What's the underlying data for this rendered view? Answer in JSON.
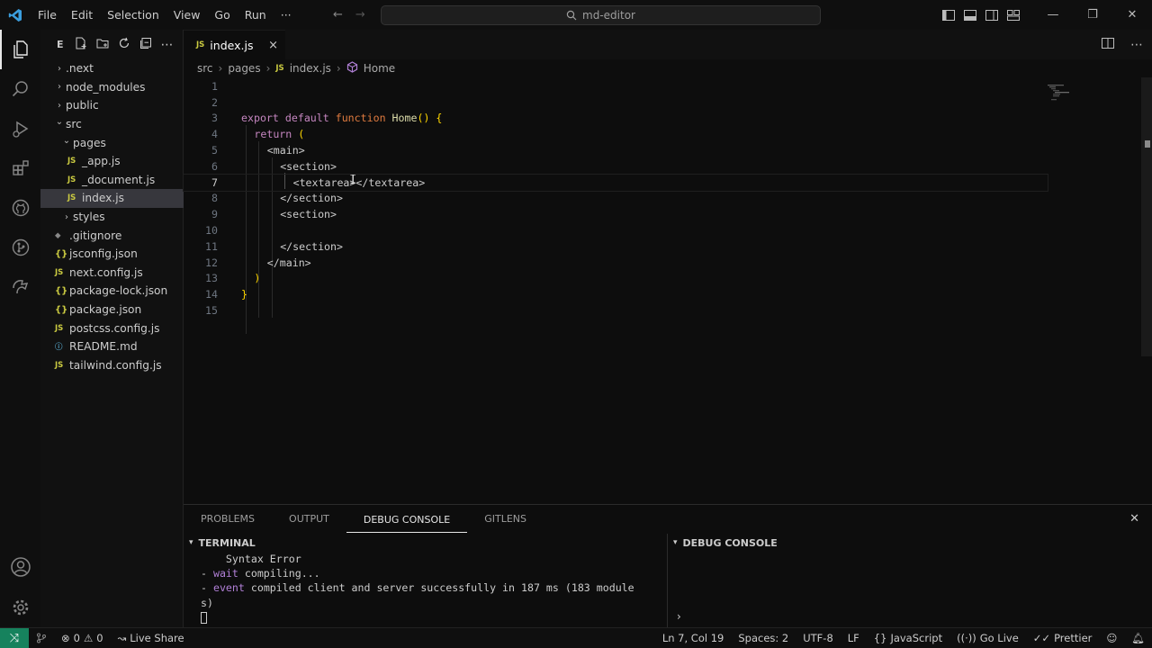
{
  "menu": [
    "File",
    "Edit",
    "Selection",
    "View",
    "Go",
    "Run",
    "···"
  ],
  "command_center": {
    "text": "md-editor"
  },
  "sidebar": {
    "header_letter": "E",
    "tree": [
      {
        "label": ".next",
        "type": "folder",
        "depth": 1,
        "open": false
      },
      {
        "label": "node_modules",
        "type": "folder",
        "depth": 1,
        "open": false
      },
      {
        "label": "public",
        "type": "folder",
        "depth": 1,
        "open": false
      },
      {
        "label": "src",
        "type": "folder",
        "depth": 1,
        "open": true
      },
      {
        "label": "pages",
        "type": "folder",
        "depth": 2,
        "open": true
      },
      {
        "label": "_app.js",
        "type": "js",
        "depth": 3
      },
      {
        "label": "_document.js",
        "type": "js",
        "depth": 3
      },
      {
        "label": "index.js",
        "type": "js",
        "depth": 3,
        "selected": true
      },
      {
        "label": "styles",
        "type": "folder",
        "depth": 2,
        "open": false
      },
      {
        "label": ".gitignore",
        "type": "git",
        "depth": 1
      },
      {
        "label": "jsconfig.json",
        "type": "json",
        "depth": 1
      },
      {
        "label": "next.config.js",
        "type": "js",
        "depth": 1
      },
      {
        "label": "package-lock.json",
        "type": "json",
        "depth": 1
      },
      {
        "label": "package.json",
        "type": "json",
        "depth": 1
      },
      {
        "label": "postcss.config.js",
        "type": "js",
        "depth": 1
      },
      {
        "label": "README.md",
        "type": "md",
        "depth": 1
      },
      {
        "label": "tailwind.config.js",
        "type": "js",
        "depth": 1
      }
    ]
  },
  "tab": {
    "label": "index.js",
    "icon_text": "JS",
    "close": "×"
  },
  "breadcrumb": {
    "parts": [
      "src",
      "pages",
      "index.js",
      "Home"
    ],
    "icon_text": "JS"
  },
  "editor": {
    "current_line": 7,
    "lines": [
      {
        "n": "1",
        "tokens": []
      },
      {
        "n": "2",
        "tokens": []
      },
      {
        "n": "3",
        "tokens": [
          {
            "t": "export ",
            "c": "k"
          },
          {
            "t": "default ",
            "c": "k"
          },
          {
            "t": "function ",
            "c": "kb"
          },
          {
            "t": "Home",
            "c": "fn"
          },
          {
            "t": "() {",
            "c": "pn"
          }
        ]
      },
      {
        "n": "4",
        "indent": 1,
        "tokens": [
          {
            "t": "return ",
            "c": "k"
          },
          {
            "t": "(",
            "c": "pn"
          }
        ]
      },
      {
        "n": "5",
        "indent": 2,
        "tokens": [
          {
            "t": "<main>",
            "c": "tg"
          }
        ]
      },
      {
        "n": "6",
        "indent": 3,
        "tokens": [
          {
            "t": "<section>",
            "c": "tg"
          }
        ]
      },
      {
        "n": "7",
        "indent": 4,
        "tokens": [
          {
            "t": "<textarea></textarea>",
            "c": "tg"
          }
        ]
      },
      {
        "n": "8",
        "indent": 3,
        "tokens": [
          {
            "t": "</section>",
            "c": "tg"
          }
        ]
      },
      {
        "n": "9",
        "indent": 3,
        "tokens": [
          {
            "t": "<section>",
            "c": "tg"
          }
        ]
      },
      {
        "n": "10",
        "tokens": []
      },
      {
        "n": "11",
        "indent": 3,
        "tokens": [
          {
            "t": "</section>",
            "c": "tg"
          }
        ]
      },
      {
        "n": "12",
        "indent": 2,
        "tokens": [
          {
            "t": "</main>",
            "c": "tg"
          }
        ]
      },
      {
        "n": "13",
        "indent": 1,
        "tokens": [
          {
            "t": ")",
            "c": "pn"
          }
        ]
      },
      {
        "n": "14",
        "tokens": [
          {
            "t": "}",
            "c": "pn"
          }
        ]
      },
      {
        "n": "15",
        "tokens": []
      }
    ]
  },
  "panel": {
    "tabs": [
      "PROBLEMS",
      "OUTPUT",
      "DEBUG CONSOLE",
      "GITLENS"
    ],
    "active_tab": "DEBUG CONSOLE",
    "terminal_header": "TERMINAL",
    "debug_header": "DEBUG CONSOLE",
    "terminal_lines": [
      {
        "prefix": "",
        "word": "",
        "text": "    Syntax Error"
      },
      {
        "prefix": "- ",
        "word": "wait",
        "text": " compiling..."
      },
      {
        "prefix": "- ",
        "word": "event",
        "text": " compiled client and server successfully in 187 ms (183 module"
      },
      {
        "prefix": "",
        "word": "",
        "text": "s)"
      }
    ]
  },
  "statusbar": {
    "errors": "0",
    "warnings": "0",
    "live_share": "Live Share",
    "position": "Ln 7, Col 19",
    "spaces": "Spaces: 2",
    "encoding": "UTF-8",
    "eol": "LF",
    "language": "JavaScript",
    "go_live": "Go Live",
    "prettier": "Prettier"
  }
}
